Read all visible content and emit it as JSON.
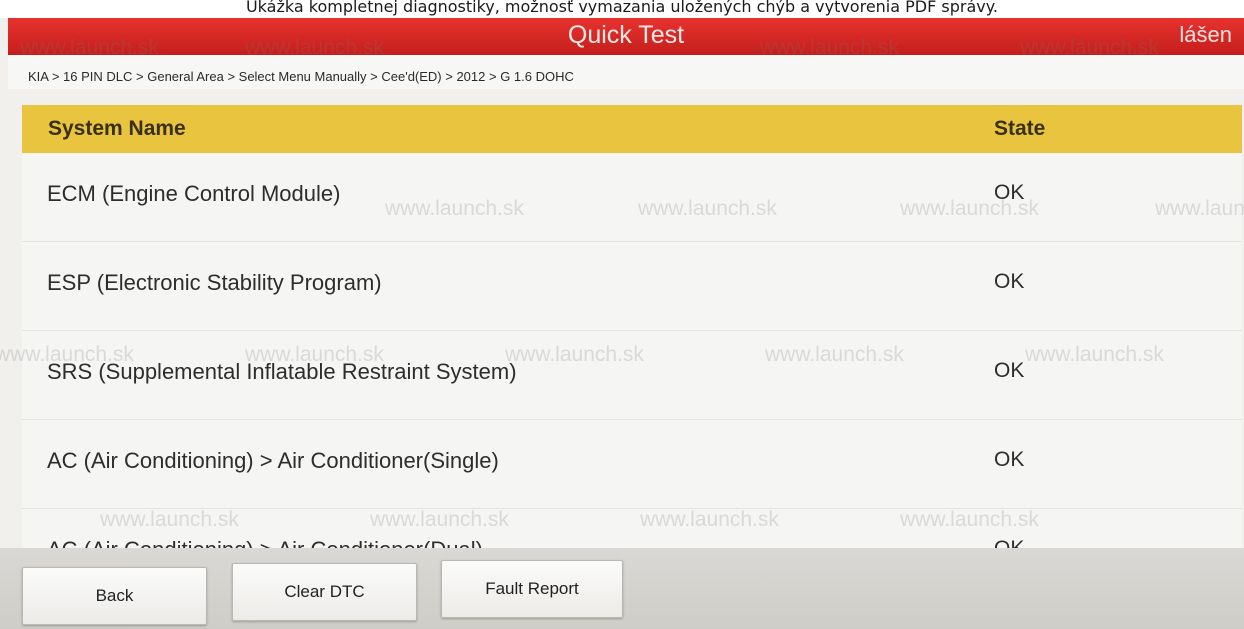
{
  "caption": "Ukážka kompletnej diagnostiky, možnosť vymazania uložených chýb a vytvorenia PDF správy.",
  "header": {
    "title": "Quick Test",
    "right_text": "lášen"
  },
  "breadcrumb": "KIA > 16 PIN DLC > General Area > Select Menu Manually > Cee'd(ED) > 2012 > G 1.6 DOHC",
  "table": {
    "columns": [
      "System Name",
      "State"
    ],
    "rows": [
      {
        "name": "ECM (Engine Control Module)",
        "state": "OK"
      },
      {
        "name": "ESP (Electronic Stability Program)",
        "state": "OK"
      },
      {
        "name": "SRS (Supplemental Inflatable Restraint System)",
        "state": "OK"
      },
      {
        "name": "AC (Air Conditioning) > Air Conditioner(Single)",
        "state": "OK"
      },
      {
        "name": "AC (Air Conditioning) > Air Conditioner(Dual)",
        "state": "OK"
      }
    ]
  },
  "footer": {
    "back": "Back",
    "clear_dtc": "Clear DTC",
    "fault_report": "Fault Report"
  },
  "watermark": "www.launch.sk",
  "colors": {
    "title_bar": "#d42826",
    "header_row": "#e9c43f"
  }
}
